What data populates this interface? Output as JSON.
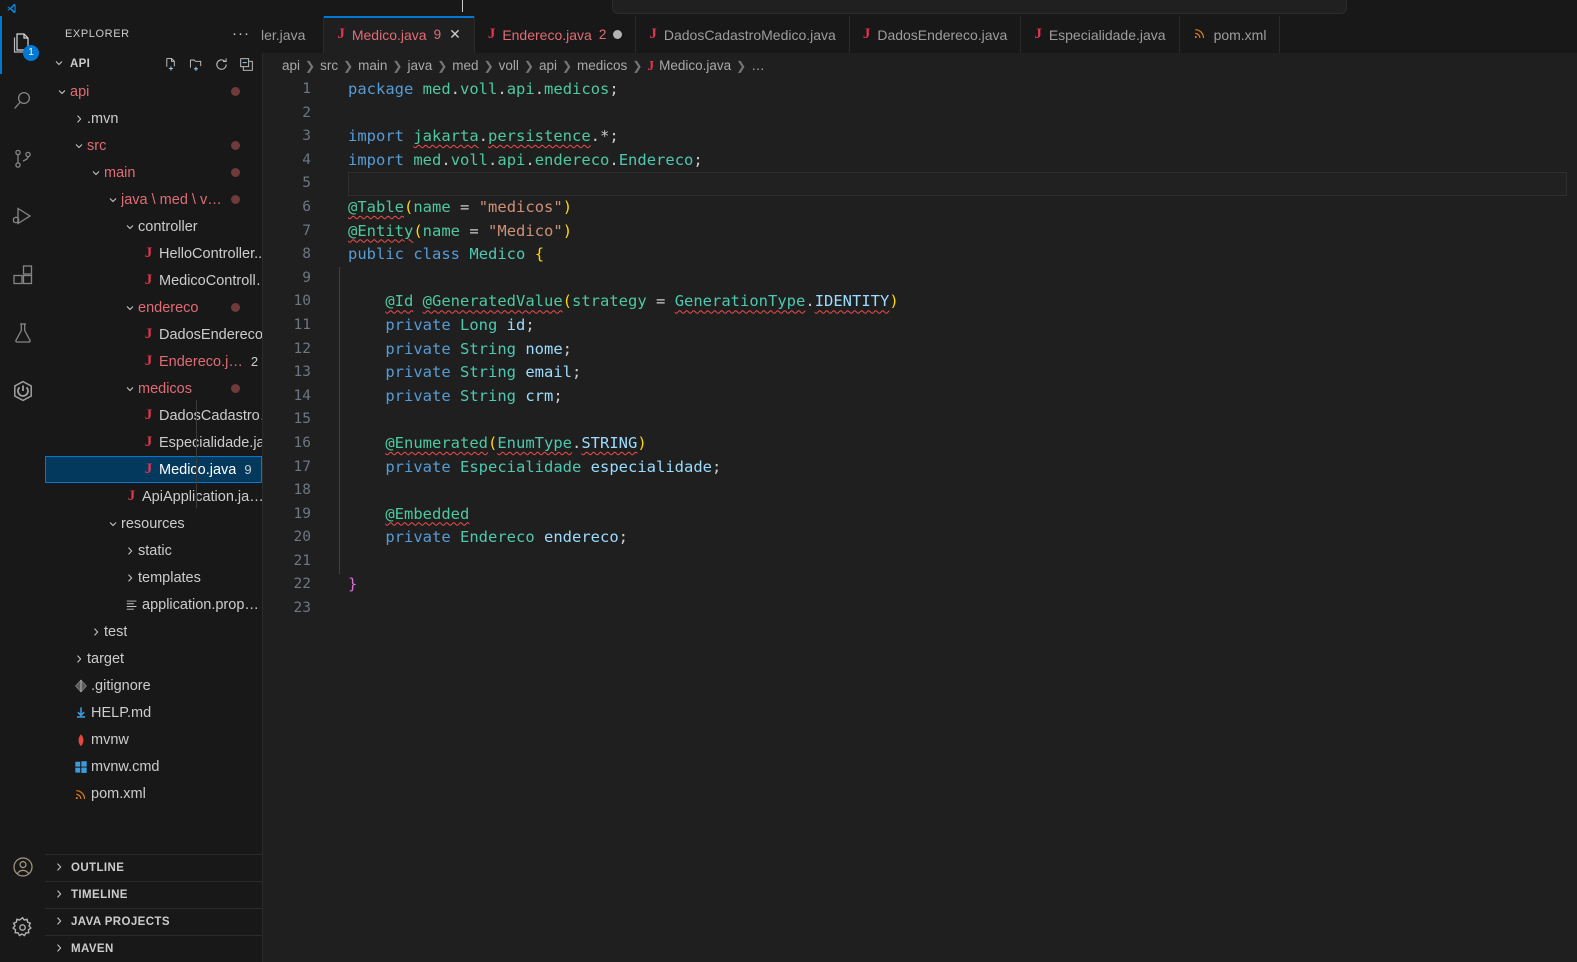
{
  "window": {
    "title_bar": {
      "command_center_placeholder": ""
    }
  },
  "activity_bar": {
    "items": [
      {
        "name": "explorer",
        "icon": "files-icon",
        "badge": "1",
        "active": true
      },
      {
        "name": "search",
        "icon": "search-icon",
        "badge": "",
        "active": false
      },
      {
        "name": "source-control",
        "icon": "source-control-icon",
        "badge": "",
        "active": false
      },
      {
        "name": "run-and-debug",
        "icon": "run-debug-icon",
        "badge": "",
        "active": false
      },
      {
        "name": "extensions",
        "icon": "extensions-icon",
        "badge": "",
        "active": false
      },
      {
        "name": "testing",
        "icon": "beaker-icon",
        "badge": "",
        "active": false
      },
      {
        "name": "spring-boot-dashboard",
        "icon": "spring-boot-icon",
        "badge": "",
        "active": false
      }
    ],
    "bottom_items": [
      {
        "name": "accounts",
        "icon": "account-icon"
      },
      {
        "name": "manage-settings",
        "icon": "gear-icon"
      }
    ]
  },
  "sidebar": {
    "title": "EXPLORER",
    "more_actions": "···",
    "root": {
      "label": "API",
      "actions": [
        "new-file-icon",
        "new-folder-icon",
        "refresh-icon",
        "collapse-all-icon"
      ]
    },
    "tree": [
      {
        "label": "api",
        "indent": 0,
        "type": "folder",
        "state": "expanded",
        "modified": true,
        "badge": ""
      },
      {
        "label": ".mvn",
        "indent": 1,
        "type": "folder",
        "state": "collapsed",
        "modified": false,
        "badge": ""
      },
      {
        "label": "src",
        "indent": 1,
        "type": "folder",
        "state": "expanded",
        "modified": true,
        "badge": ""
      },
      {
        "label": "main",
        "indent": 2,
        "type": "folder",
        "state": "expanded",
        "modified": true,
        "badge": ""
      },
      {
        "label": "java \\ med \\ v…",
        "indent": 3,
        "type": "folder",
        "state": "expanded",
        "modified": true,
        "badge": ""
      },
      {
        "label": "controller",
        "indent": 4,
        "type": "folder",
        "state": "expanded",
        "modified": false,
        "badge": ""
      },
      {
        "label": "HelloController....",
        "indent": 5,
        "type": "java",
        "state": "file",
        "modified": false,
        "badge": ""
      },
      {
        "label": "MedicoControll…",
        "indent": 5,
        "type": "java",
        "state": "file",
        "modified": false,
        "badge": ""
      },
      {
        "label": "endereco",
        "indent": 4,
        "type": "folder",
        "state": "expanded",
        "modified": true,
        "badge": ""
      },
      {
        "label": "DadosEndereco…",
        "indent": 5,
        "type": "java",
        "state": "file",
        "modified": false,
        "badge": ""
      },
      {
        "label": "Endereco.j…",
        "indent": 5,
        "type": "java",
        "state": "file",
        "modified": true,
        "badge": "2"
      },
      {
        "label": "medicos",
        "indent": 4,
        "type": "folder",
        "state": "expanded",
        "modified": true,
        "badge": ""
      },
      {
        "label": "DadosCadastro…",
        "indent": 5,
        "type": "java",
        "state": "file",
        "modified": false,
        "badge": ""
      },
      {
        "label": "Especialidade.ja…",
        "indent": 5,
        "type": "java",
        "state": "file",
        "modified": false,
        "badge": ""
      },
      {
        "label": "Medico.java",
        "indent": 5,
        "type": "java",
        "state": "file",
        "modified": false,
        "badge": "9",
        "selected": true
      },
      {
        "label": "ApiApplication.ja…",
        "indent": 4,
        "type": "java",
        "state": "file",
        "modified": false,
        "badge": ""
      },
      {
        "label": "resources",
        "indent": 3,
        "type": "folder",
        "state": "expanded",
        "modified": false,
        "badge": ""
      },
      {
        "label": "static",
        "indent": 4,
        "type": "folder",
        "state": "collapsed",
        "modified": false,
        "badge": ""
      },
      {
        "label": "templates",
        "indent": 4,
        "type": "folder",
        "state": "collapsed",
        "modified": false,
        "badge": ""
      },
      {
        "label": "application.prop…",
        "indent": 4,
        "type": "props",
        "state": "file",
        "modified": false,
        "badge": ""
      },
      {
        "label": "test",
        "indent": 2,
        "type": "folder",
        "state": "collapsed",
        "modified": false,
        "badge": ""
      },
      {
        "label": "target",
        "indent": 1,
        "type": "folder",
        "state": "collapsed",
        "modified": false,
        "badge": ""
      },
      {
        "label": ".gitignore",
        "indent": 1,
        "type": "git",
        "state": "file",
        "modified": false,
        "badge": ""
      },
      {
        "label": "HELP.md",
        "indent": 1,
        "type": "md",
        "state": "file",
        "modified": false,
        "badge": ""
      },
      {
        "label": "mvnw",
        "indent": 1,
        "type": "maven",
        "state": "file",
        "modified": false,
        "badge": ""
      },
      {
        "label": "mvnw.cmd",
        "indent": 1,
        "type": "cmd",
        "state": "file",
        "modified": false,
        "badge": ""
      },
      {
        "label": "pom.xml",
        "indent": 1,
        "type": "xml",
        "state": "file",
        "modified": false,
        "badge": ""
      }
    ],
    "panels": [
      {
        "label": "OUTLINE"
      },
      {
        "label": "TIMELINE"
      },
      {
        "label": "JAVA PROJECTS"
      },
      {
        "label": "MAVEN"
      }
    ]
  },
  "editor": {
    "tabs": [
      {
        "label": "ler.java",
        "icon": "",
        "errors": "",
        "active": false,
        "dirty": false,
        "clipped": true
      },
      {
        "label": "Medico.java",
        "icon": "java-icon",
        "errors": "9",
        "active": true,
        "dirty": false,
        "close": "✕"
      },
      {
        "label": "Endereco.java",
        "icon": "java-icon",
        "errors": "2",
        "active": false,
        "dirty": true
      },
      {
        "label": "DadosCadastroMedico.java",
        "icon": "java-icon",
        "errors": "",
        "active": false,
        "dirty": false
      },
      {
        "label": "DadosEndereco.java",
        "icon": "java-icon",
        "errors": "",
        "active": false,
        "dirty": false
      },
      {
        "label": "Especialidade.java",
        "icon": "java-icon",
        "errors": "",
        "active": false,
        "dirty": false
      },
      {
        "label": "pom.xml",
        "icon": "xml-icon",
        "errors": "",
        "active": false,
        "dirty": false
      }
    ],
    "breadcrumb": {
      "segments": [
        "api",
        "src",
        "main",
        "java",
        "med",
        "voll",
        "api",
        "medicos"
      ],
      "file": "Medico.java",
      "trailing": "…"
    },
    "language": "java",
    "current_line": 5,
    "line_count": 23,
    "lines": [
      {
        "n": 1,
        "text": "package med.voll.api.medicos;"
      },
      {
        "n": 2,
        "text": ""
      },
      {
        "n": 3,
        "text": "import jakarta.persistence.*;"
      },
      {
        "n": 4,
        "text": "import med.voll.api.endereco.Endereco;"
      },
      {
        "n": 5,
        "text": ""
      },
      {
        "n": 6,
        "text": "@Table(name = \"medicos\")"
      },
      {
        "n": 7,
        "text": "@Entity(name = \"Medico\")"
      },
      {
        "n": 8,
        "text": "public class Medico {"
      },
      {
        "n": 9,
        "text": ""
      },
      {
        "n": 10,
        "text": "    @Id @GeneratedValue(strategy = GenerationType.IDENTITY)"
      },
      {
        "n": 11,
        "text": "    private Long id;"
      },
      {
        "n": 12,
        "text": "    private String nome;"
      },
      {
        "n": 13,
        "text": "    private String email;"
      },
      {
        "n": 14,
        "text": "    private String crm;"
      },
      {
        "n": 15,
        "text": ""
      },
      {
        "n": 16,
        "text": "    @Enumerated(EnumType.STRING)"
      },
      {
        "n": 17,
        "text": "    private Especialidade especialidade;"
      },
      {
        "n": 18,
        "text": ""
      },
      {
        "n": 19,
        "text": "    @Embedded"
      },
      {
        "n": 20,
        "text": "    private Endereco endereco;"
      },
      {
        "n": 21,
        "text": ""
      },
      {
        "n": 22,
        "text": "}"
      },
      {
        "n": 23,
        "text": ""
      }
    ]
  },
  "colors": {
    "accent": "#0078d4",
    "editor_bg": "#1f1f1f",
    "chrome_bg": "#181818",
    "error": "#e06c75",
    "selected_row": "#04395e",
    "keyword": "#569cd6",
    "type": "#4ec9a0",
    "string": "#ce9178",
    "variable": "#9cdcfe",
    "bracket1": "#ffd700",
    "bracket2": "#da70d6",
    "java_icon": "#e1344d",
    "squiggle": "#f14c4c"
  }
}
